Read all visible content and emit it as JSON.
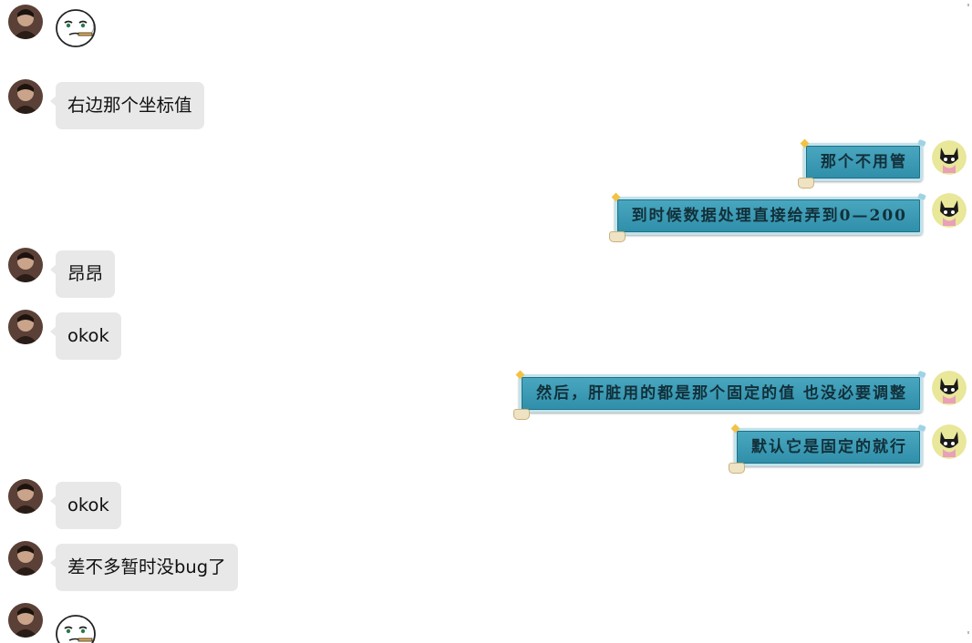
{
  "messages": [
    {
      "from": "other",
      "type": "sticker",
      "sticker": "face-with-cigarette-sticker"
    },
    {
      "from": "other",
      "type": "text",
      "text": "右边那个坐标值"
    },
    {
      "from": "me",
      "type": "text",
      "text": "那个不用管"
    },
    {
      "from": "me",
      "type": "text",
      "text": "到时候数据处理直接给弄到0—200"
    },
    {
      "from": "other",
      "type": "text",
      "text": "昂昂"
    },
    {
      "from": "other",
      "type": "text",
      "text": "okok"
    },
    {
      "from": "me",
      "type": "text",
      "text": "然后，肝脏用的都是那个固定的值 也没必要调整"
    },
    {
      "from": "me",
      "type": "text",
      "text": "默认它是固定的就行"
    },
    {
      "from": "other",
      "type": "text",
      "text": "okok"
    },
    {
      "from": "other",
      "type": "text",
      "text": "差不多暂时没bug了"
    },
    {
      "from": "other",
      "type": "sticker",
      "sticker": "face-with-cigarette-sticker"
    }
  ],
  "colors": {
    "incoming_bubble": "#e8e8e8",
    "outgoing_bubble": "#3a9bb5",
    "background": "#ffffff"
  }
}
